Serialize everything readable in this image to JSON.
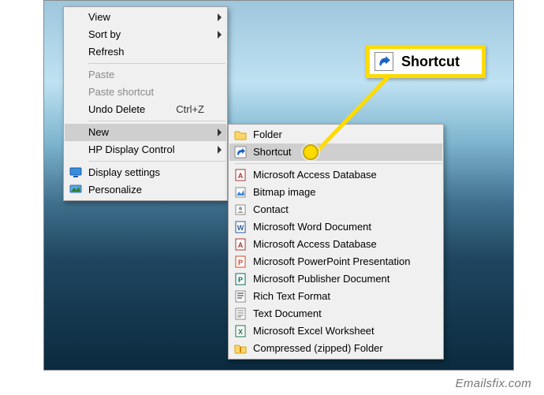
{
  "watermark": "Emailsfix.com",
  "context_menu": {
    "items": [
      {
        "label": "View",
        "arrow": true
      },
      {
        "label": "Sort by",
        "arrow": true
      },
      {
        "label": "Refresh"
      }
    ],
    "paste": "Paste",
    "paste_shortcut": "Paste shortcut",
    "undo": {
      "label": "Undo Delete",
      "shortcut": "Ctrl+Z"
    },
    "new": "New",
    "hp": "HP Display Control",
    "display_settings": "Display settings",
    "personalize": "Personalize"
  },
  "new_submenu": {
    "folder": "Folder",
    "shortcut": "Shortcut",
    "items": [
      "Microsoft Access Database",
      "Bitmap image",
      "Contact",
      "Microsoft Word Document",
      "Microsoft Access Database",
      "Microsoft PowerPoint Presentation",
      "Microsoft Publisher Document",
      "Rich Text Format",
      "Text Document",
      "Microsoft Excel Worksheet",
      "Compressed (zipped) Folder"
    ]
  },
  "callout": {
    "label": "Shortcut"
  },
  "icons": {
    "folder": "folder-icon",
    "shortcut": "shortcut-arrow-icon",
    "access": "access-icon",
    "bitmap": "bitmap-icon",
    "contact": "contact-icon",
    "word": "word-icon",
    "ppt": "powerpoint-icon",
    "publisher": "publisher-icon",
    "rtf": "rtf-icon",
    "text": "text-icon",
    "excel": "excel-icon",
    "zip": "zip-icon",
    "monitor": "monitor-icon",
    "personalize": "personalize-icon"
  }
}
